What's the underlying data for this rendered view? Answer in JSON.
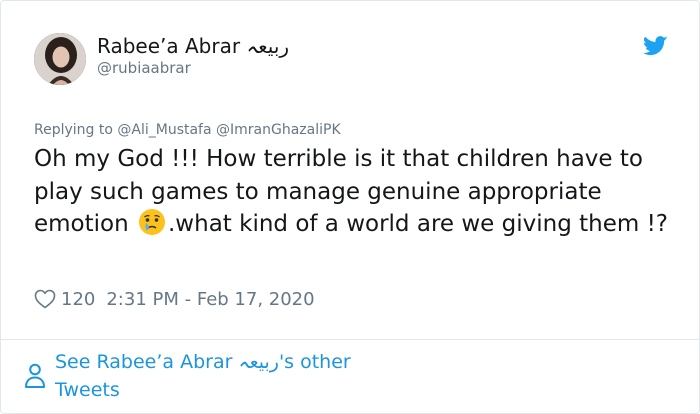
{
  "tweet": {
    "author_name": "Rabee’a Abrar ربیعہ",
    "author_handle": "@rubiaabrar",
    "replying_prefix": "Replying to",
    "replying_to": [
      "@Ali_Mustafa",
      "@ImranGhazaliPK"
    ],
    "text_part1": "Oh my God !!! How terrible is it that children have to play such games to manage genuine appropriate emotion",
    "emoji": "crying-face-emoji",
    "text_part2": ".what kind of a world are we giving them !?",
    "likes": "120",
    "timestamp": "2:31 PM - Feb 17, 2020"
  },
  "footer": {
    "see_more_label": "See Rabee’a Abrar ربیعہ's other Tweets"
  },
  "colors": {
    "twitter_blue": "#1da1f2",
    "link_blue": "#1b95e0",
    "text_primary": "#14171a",
    "text_secondary": "#657786",
    "border": "#e1e8ed"
  },
  "icons": {
    "brand": "twitter-bird-icon",
    "like": "heart-outline-icon",
    "profile": "person-icon"
  }
}
